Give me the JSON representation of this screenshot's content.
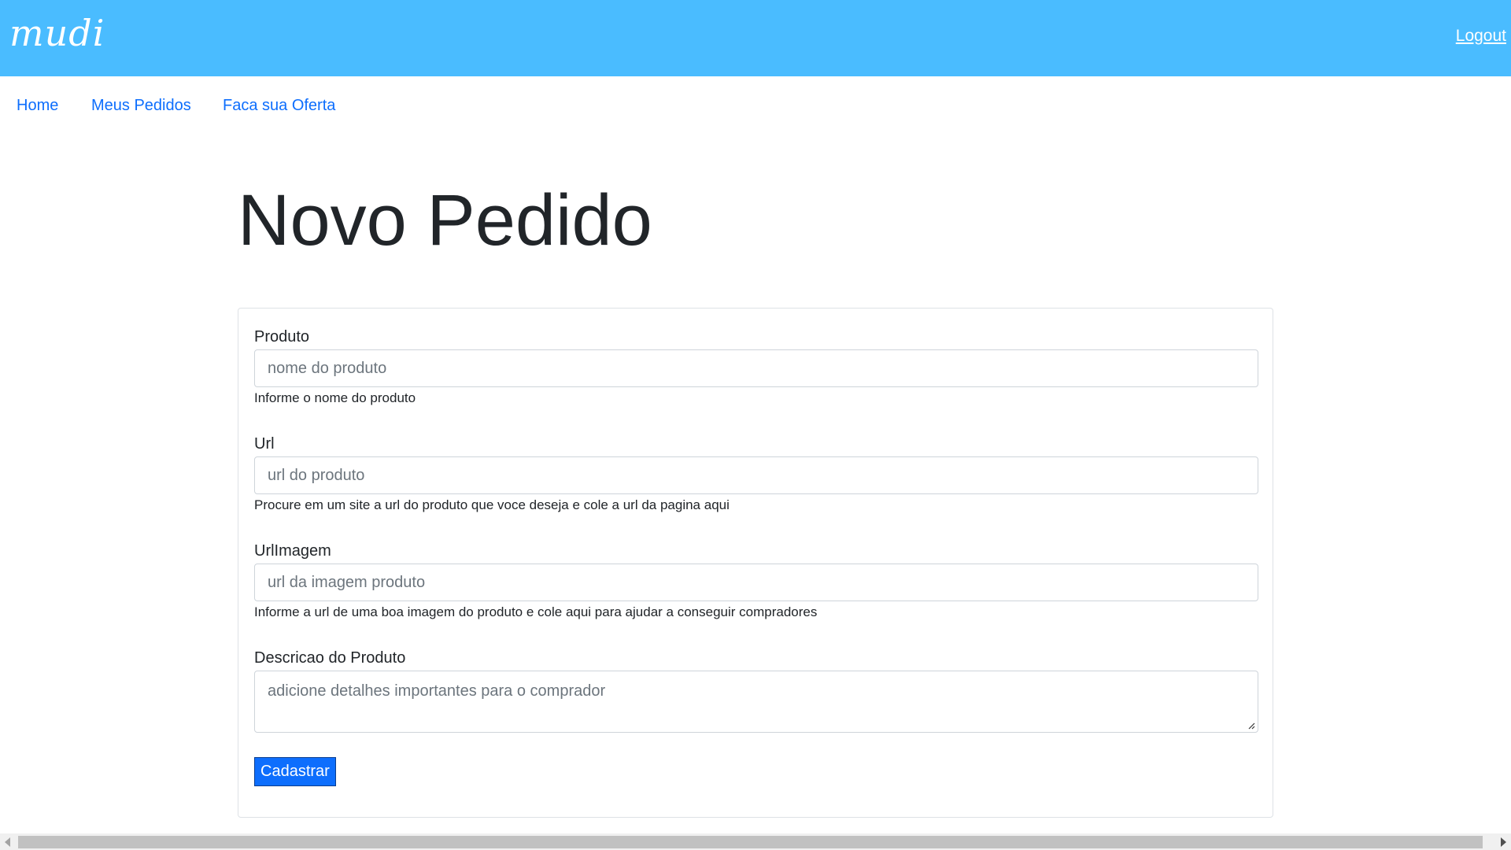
{
  "header": {
    "logo_text": "mudi",
    "logout_label": "Logout",
    "background_color": "#4abcff"
  },
  "nav": {
    "items": [
      {
        "label": "Home"
      },
      {
        "label": "Meus Pedidos"
      },
      {
        "label": "Faca sua Oferta"
      }
    ],
    "link_color": "#0d6efd"
  },
  "main": {
    "title": "Novo Pedido",
    "form": {
      "fields": [
        {
          "label": "Produto",
          "placeholder": "nome do produto",
          "help": "Informe o nome do produto"
        },
        {
          "label": "Url",
          "placeholder": "url do produto",
          "help": "Procure em um site a url do produto que voce deseja e cole a url da pagina aqui"
        },
        {
          "label": "UrlImagem",
          "placeholder": "url da imagem produto",
          "help": "Informe a url de uma boa imagem do produto e cole aqui para ajudar a conseguir compradores"
        },
        {
          "label": "Descricao do Produto",
          "placeholder": "adicione detalhes importantes para o comprador"
        }
      ],
      "submit_label": "Cadastrar",
      "submit_color": "#0d6efd"
    }
  }
}
